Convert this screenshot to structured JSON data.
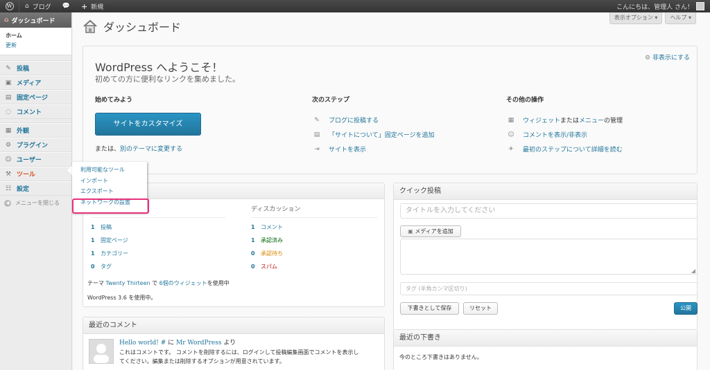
{
  "adminbar": {
    "site_name": "ブログ",
    "new_label": "新規",
    "greeting": "こんにちは、管理人 さん！"
  },
  "sidebar": {
    "dashboard": "ダッシュボード",
    "sub_home": "ホーム",
    "sub_updates": "更新",
    "items": [
      {
        "label": "投稿",
        "icon": "pin-icon"
      },
      {
        "label": "メディア",
        "icon": "media-icon"
      },
      {
        "label": "固定ページ",
        "icon": "page-icon"
      },
      {
        "label": "コメント",
        "icon": "comment-icon"
      },
      {
        "label": "外観",
        "icon": "appearance-icon"
      },
      {
        "label": "プラグイン",
        "icon": "plugin-icon"
      },
      {
        "label": "ユーザー",
        "icon": "users-icon"
      },
      {
        "label": "ツール",
        "icon": "tools-icon"
      },
      {
        "label": "設定",
        "icon": "settings-icon"
      }
    ],
    "collapse": "メニューを閉じる"
  },
  "tools_flyout": [
    "利用可能なツール",
    "インポート",
    "エクスポート",
    "ネットワークの設置"
  ],
  "header": {
    "title": "ダッシュボード",
    "screen_options": "表示オプション ▾",
    "help": "ヘルプ ▾"
  },
  "welcome": {
    "dismiss": "非表示にする",
    "title": "WordPress へようこそ！",
    "about": "初めての方に便利なリンクを集めました。",
    "col1_title": "始めてみよう",
    "customize_button": "サイトをカスタマイズ",
    "or_text": "または、",
    "change_theme": "別のテーマに変更する",
    "col2_title": "次のステップ",
    "next_steps": [
      "ブログに投稿する",
      "「サイトについて」固定ページを追加",
      "サイトを表示"
    ],
    "col3_title": "その他の操作",
    "more_widgets": "ウィジェット",
    "more_or": "または",
    "more_menus": "メニュー",
    "more_manage": "の管理",
    "more_comments": "コメントを表示/非表示",
    "more_learn": "最初のステップについて詳細を読む"
  },
  "right_now": {
    "content_head": "コンテンツ",
    "discussion_head": "ディスカッション",
    "content_rows": [
      {
        "num": "1",
        "label": "投稿"
      },
      {
        "num": "1",
        "label": "固定ページ"
      },
      {
        "num": "1",
        "label": "カテゴリー"
      },
      {
        "num": "0",
        "label": "タグ"
      }
    ],
    "discussion_rows": [
      {
        "num": "1",
        "label": "コメント",
        "color": "#21759b"
      },
      {
        "num": "1",
        "label": "承認済み",
        "color": "#006505"
      },
      {
        "num": "0",
        "label": "承認待ち",
        "color": "#d98500"
      },
      {
        "num": "0",
        "label": "スパム",
        "color": "#bc0b0b"
      }
    ],
    "theme_prefix": "テーマ ",
    "theme_name": "Twenty Thirteen",
    "theme_mid": " で ",
    "widgets": "6個のウィジェット",
    "theme_suffix": "を使用中",
    "version_text": "WordPress 3.6 を使用中。"
  },
  "recent_comments": {
    "title": "最近のコメント",
    "post_link": "Hello world! #",
    "on_text": " に ",
    "author": "Mr WordPress",
    "from_text": " より",
    "excerpt_1": "これはコメントです。 コメントを削除するには、ログインして投稿編集画面でコメントを表示し",
    "excerpt_2": "てください。編集または削除するオプションが用意されています。"
  },
  "quick_press": {
    "title": "クイック投稿",
    "title_placeholder": "タイトルを入力してください",
    "add_media": "メディアを追加",
    "tags_placeholder": "タグ (半角カンマ区切り)",
    "save_draft": "下書きとして保存",
    "reset": "リセット",
    "publish": "公開"
  },
  "recent_drafts": {
    "title": "最近の下書き",
    "empty": "今のところ下書きはありません。"
  },
  "colors": {
    "accent": "#21759b",
    "highlight": "#e8307a",
    "tools_active": "#d54e21"
  }
}
